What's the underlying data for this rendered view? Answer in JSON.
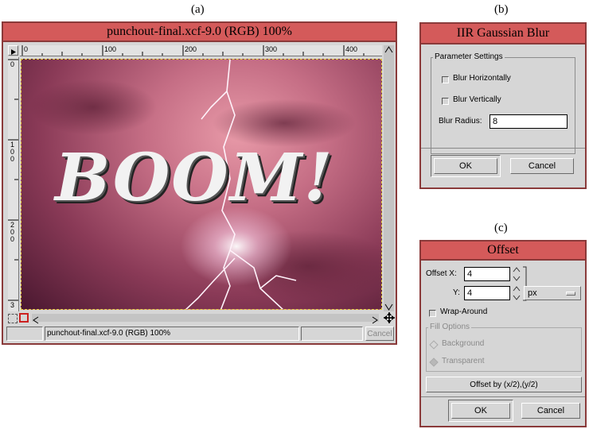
{
  "captions": {
    "a": "(a)",
    "b": "(b)",
    "c": "(c)"
  },
  "image_window": {
    "title": "punchout-final.xcf-9.0 (RGB) 100%",
    "ruler_h_ticks": [
      "0",
      "100",
      "200",
      "300",
      "400"
    ],
    "ruler_v_ticks": [
      "0",
      "100",
      "200",
      "3"
    ],
    "canvas_text": "BOOM!",
    "status_text": "punchout-final.xcf-9.0 (RGB) 100%",
    "cancel_label": "Cancel"
  },
  "blur_dialog": {
    "title": "IIR Gaussian Blur",
    "group_title": "Parameter Settings",
    "blur_h_label": "Blur Horizontally",
    "blur_v_label": "Blur Vertically",
    "radius_label": "Blur Radius:",
    "radius_value": "8",
    "ok_label": "OK",
    "cancel_label": "Cancel"
  },
  "offset_dialog": {
    "title": "Offset",
    "offset_x_label": "Offset X:",
    "offset_x_value": "4",
    "offset_y_label": "Y:",
    "offset_y_value": "4",
    "unit_value": "px",
    "wrap_label": "Wrap-Around",
    "fill_title": "Fill Options",
    "background_label": "Background",
    "transparent_label": "Transparent",
    "offset_half_label": "Offset by (x/2),(y/2)",
    "ok_label": "OK",
    "cancel_label": "Cancel"
  },
  "colors": {
    "title_bar": "#d45a5a",
    "border": "#8a3a3a",
    "panel": "#d6d6d6"
  }
}
